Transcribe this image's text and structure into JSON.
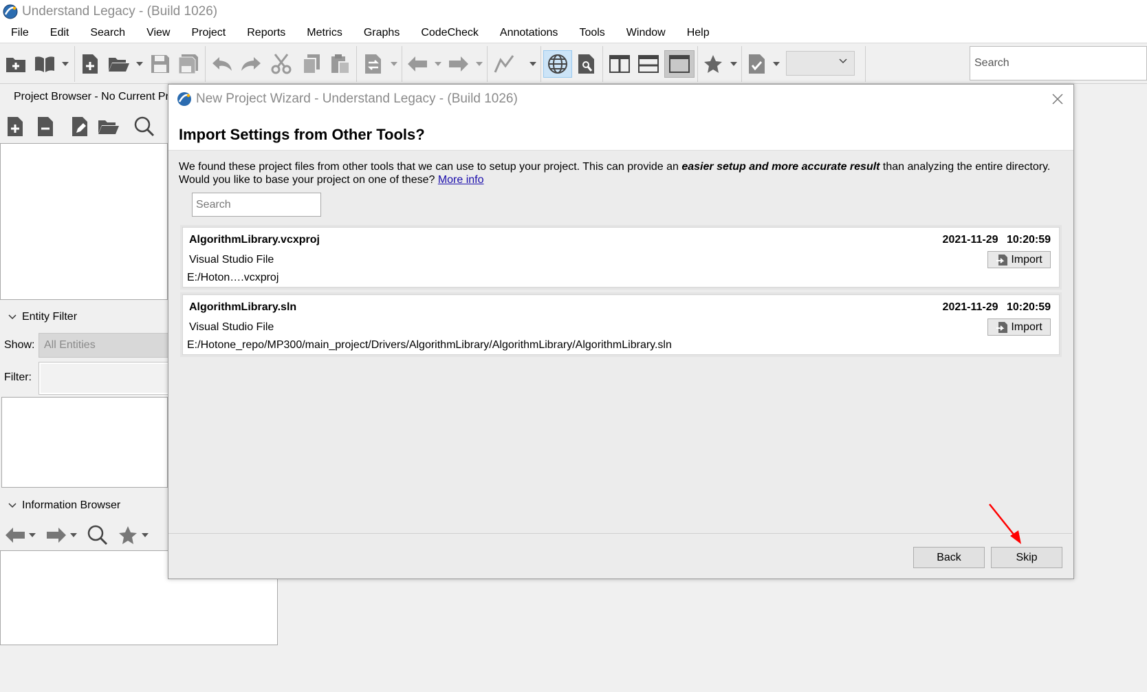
{
  "window": {
    "title": "Understand Legacy - (Build 1026)"
  },
  "menu": [
    "File",
    "Edit",
    "Search",
    "View",
    "Project",
    "Reports",
    "Metrics",
    "Graphs",
    "CodeCheck",
    "Annotations",
    "Tools",
    "Window",
    "Help"
  ],
  "toolbar": {
    "search_placeholder": "Search"
  },
  "left_panel": {
    "project_browser_title": "Project Browser - No Current Pr",
    "entity_filter_title": "Entity Filter",
    "show_label": "Show:",
    "show_value": "All Entities",
    "filter_label": "Filter:",
    "information_browser_title": "Information Browser"
  },
  "dialog": {
    "title": "New Project Wizard - Understand Legacy - (Build 1026)",
    "heading": "Import Settings from Other Tools?",
    "description_part1": "We found these project files from other tools that we can use to setup your project. This can provide an ",
    "description_emphasis": "easier setup and more accurate result",
    "description_part2": " than analyzing the entire directory. Would you like to base your project on one of these? ",
    "more_info_link": "More info",
    "search_placeholder": "Search",
    "projects": [
      {
        "name": "AlgorithmLibrary.vcxproj",
        "datetime": "2021-11-29 10:20:59",
        "type": "Visual Studio File",
        "path": "E:/Hoton….vcxproj",
        "import_label": "Import"
      },
      {
        "name": "AlgorithmLibrary.sln",
        "datetime": "2021-11-29 10:20:59",
        "type": "Visual Studio File",
        "path": "E:/Hotone_repo/MP300/main_project/Drivers/AlgorithmLibrary/AlgorithmLibrary/AlgorithmLibrary.sln",
        "import_label": "Import"
      }
    ],
    "back_label": "Back",
    "skip_label": "Skip"
  },
  "colors": {
    "link": "#1a0dab",
    "annotation_arrow": "#ff0000",
    "active_tool": "#cce4f7"
  }
}
